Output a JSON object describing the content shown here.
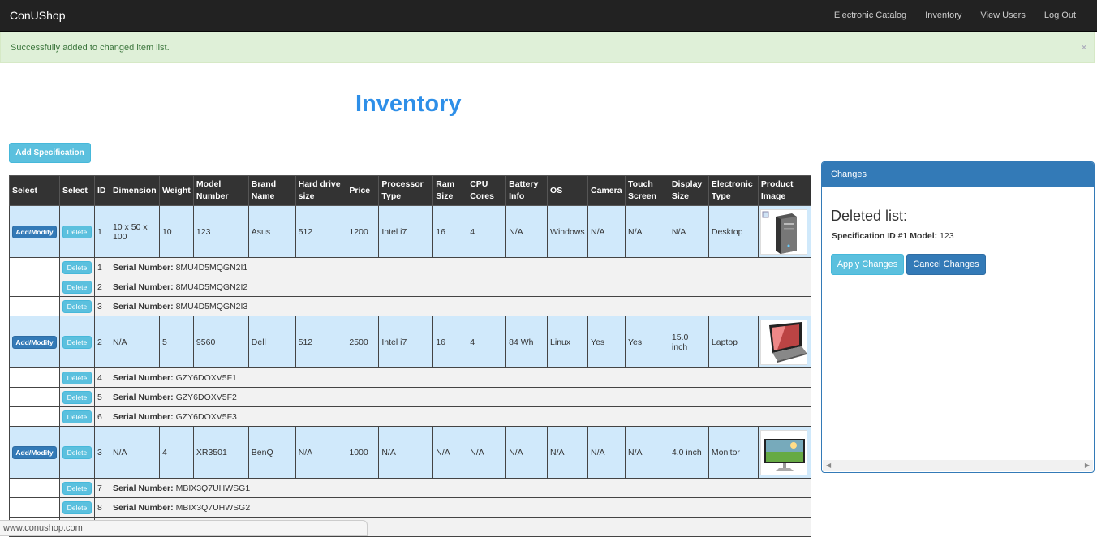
{
  "navbar": {
    "brand": "ConUShop",
    "links": [
      "Electronic Catalog",
      "Inventory",
      "View Users",
      "Log Out"
    ]
  },
  "alert": {
    "message": "Successfully added to changed item list.",
    "close": "×"
  },
  "page_title": "Inventory",
  "add_spec_label": "Add Specification",
  "table": {
    "headers": [
      "Select",
      "Select",
      "ID",
      "Dimension",
      "Weight",
      "Model Number",
      "Brand Name",
      "Hard drive size",
      "Price",
      "Processor Type",
      "Ram Size",
      "CPU Cores",
      "Battery Info",
      "OS",
      "Camera",
      "Touch Screen",
      "Display Size",
      "Electronic Type",
      "Product Image"
    ],
    "add_label": "Add/Modify",
    "delete_label": "Delete",
    "serial_label": "Serial Number:",
    "specs": [
      {
        "cells": [
          "1",
          "10 x 50 x 100",
          "10",
          "123",
          "Asus",
          "512",
          "1200",
          "Intel i7",
          "16",
          "4",
          "N/A",
          "Windows",
          "N/A",
          "N/A",
          "N/A",
          "Desktop"
        ],
        "image": "desktop-tower",
        "items": [
          {
            "id": "1",
            "serial": "8MU4D5MQGN2I1"
          },
          {
            "id": "2",
            "serial": "8MU4D5MQGN2I2"
          },
          {
            "id": "3",
            "serial": "8MU4D5MQGN2I3"
          }
        ]
      },
      {
        "cells": [
          "2",
          "N/A",
          "5",
          "9560",
          "Dell",
          "512",
          "2500",
          "Intel i7",
          "16",
          "4",
          "84 Wh",
          "Linux",
          "Yes",
          "Yes",
          "15.0 inch",
          "Laptop"
        ],
        "image": "laptop",
        "items": [
          {
            "id": "4",
            "serial": "GZY6DOXV5F1"
          },
          {
            "id": "5",
            "serial": "GZY6DOXV5F2"
          },
          {
            "id": "6",
            "serial": "GZY6DOXV5F3"
          }
        ]
      },
      {
        "cells": [
          "3",
          "N/A",
          "4",
          "XR3501",
          "BenQ",
          "N/A",
          "1000",
          "N/A",
          "N/A",
          "N/A",
          "N/A",
          "N/A",
          "N/A",
          "N/A",
          "4.0 inch",
          "Monitor"
        ],
        "image": "monitor",
        "items": [
          {
            "id": "7",
            "serial": "MBIX3Q7UHWSG1"
          },
          {
            "id": "8",
            "serial": "MBIX3Q7UHWSG2"
          }
        ]
      }
    ]
  },
  "changes_panel": {
    "title": "Changes",
    "deleted_heading": "Deleted list:",
    "deleted_item_label": "Specification ID #1 Model:",
    "deleted_item_model": "123",
    "apply_label": "Apply Changes",
    "cancel_label": "Cancel Changes"
  },
  "status_url": "www.conushop.com",
  "colors": {
    "navbar": "#222222",
    "alert_bg": "#dff0d8",
    "title": "#2e8fe8",
    "spec_row": "#d0e9fb",
    "primary": "#337ab7",
    "info": "#5bc0de"
  }
}
